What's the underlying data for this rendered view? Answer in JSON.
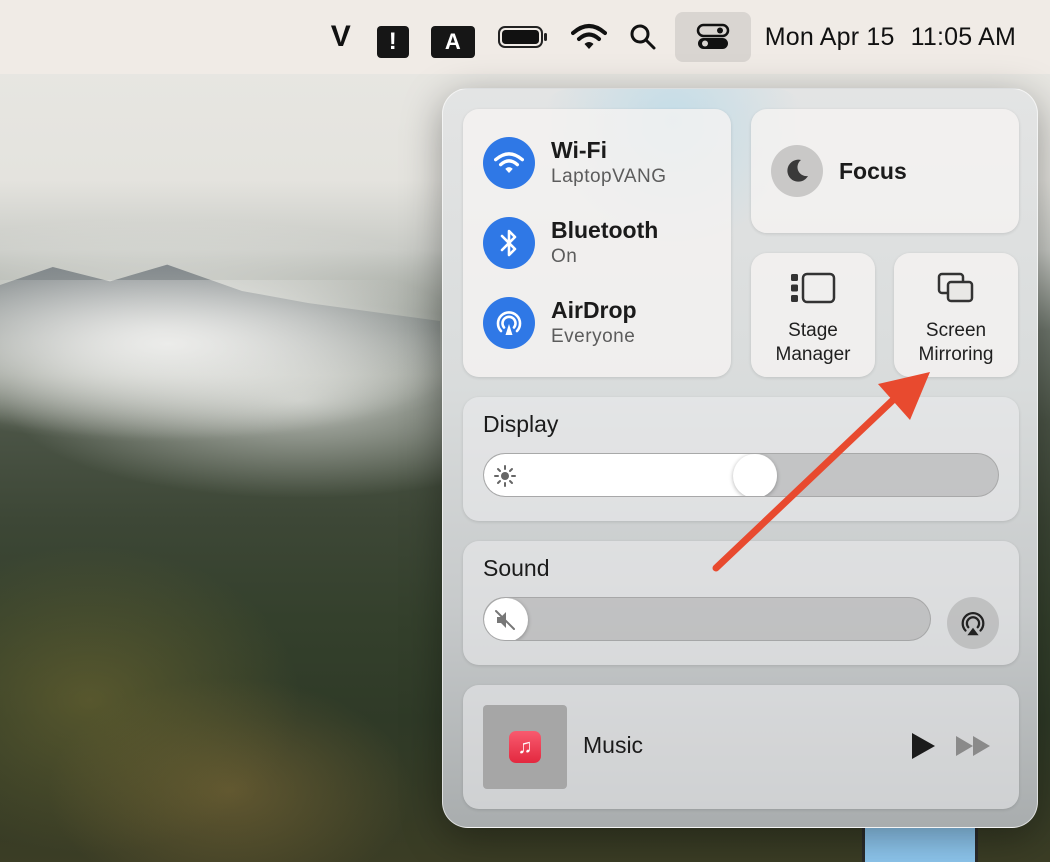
{
  "menubar": {
    "items": [
      {
        "name": "v-app-icon"
      },
      {
        "name": "alert-app-icon"
      },
      {
        "name": "text-input-a-icon"
      },
      {
        "name": "battery-icon"
      },
      {
        "name": "wifi-icon"
      },
      {
        "name": "spotlight-search-icon"
      },
      {
        "name": "control-center-icon"
      }
    ],
    "v_glyph": "V",
    "excl_glyph": "!",
    "a_glyph": "A",
    "date": "Mon Apr 15",
    "time": "11:05 AM"
  },
  "control_center": {
    "connectivity": [
      {
        "title": "Wi-Fi",
        "subtitle": "LaptopVANG",
        "icon": "wifi-icon"
      },
      {
        "title": "Bluetooth",
        "subtitle": "On",
        "icon": "bluetooth-icon"
      },
      {
        "title": "AirDrop",
        "subtitle": "Everyone",
        "icon": "airdrop-icon"
      }
    ],
    "focus": {
      "label": "Focus",
      "icon": "moon-icon"
    },
    "stage_manager": {
      "label": "Stage\nManager",
      "icon": "stage-manager-icon"
    },
    "screen_mirroring": {
      "label": "Screen\nMirroring",
      "icon": "screen-mirroring-icon"
    },
    "display": {
      "title": "Display",
      "brightness_percent": 53
    },
    "sound": {
      "title": "Sound",
      "volume_percent": 0,
      "muted": true
    },
    "now_playing": {
      "title": "Music",
      "icon": "music-app-icon"
    }
  },
  "colors": {
    "accent_blue": "#2f78e6",
    "annotation_arrow": "#e84a2f",
    "menubar_bg": "#f0ebe6"
  }
}
